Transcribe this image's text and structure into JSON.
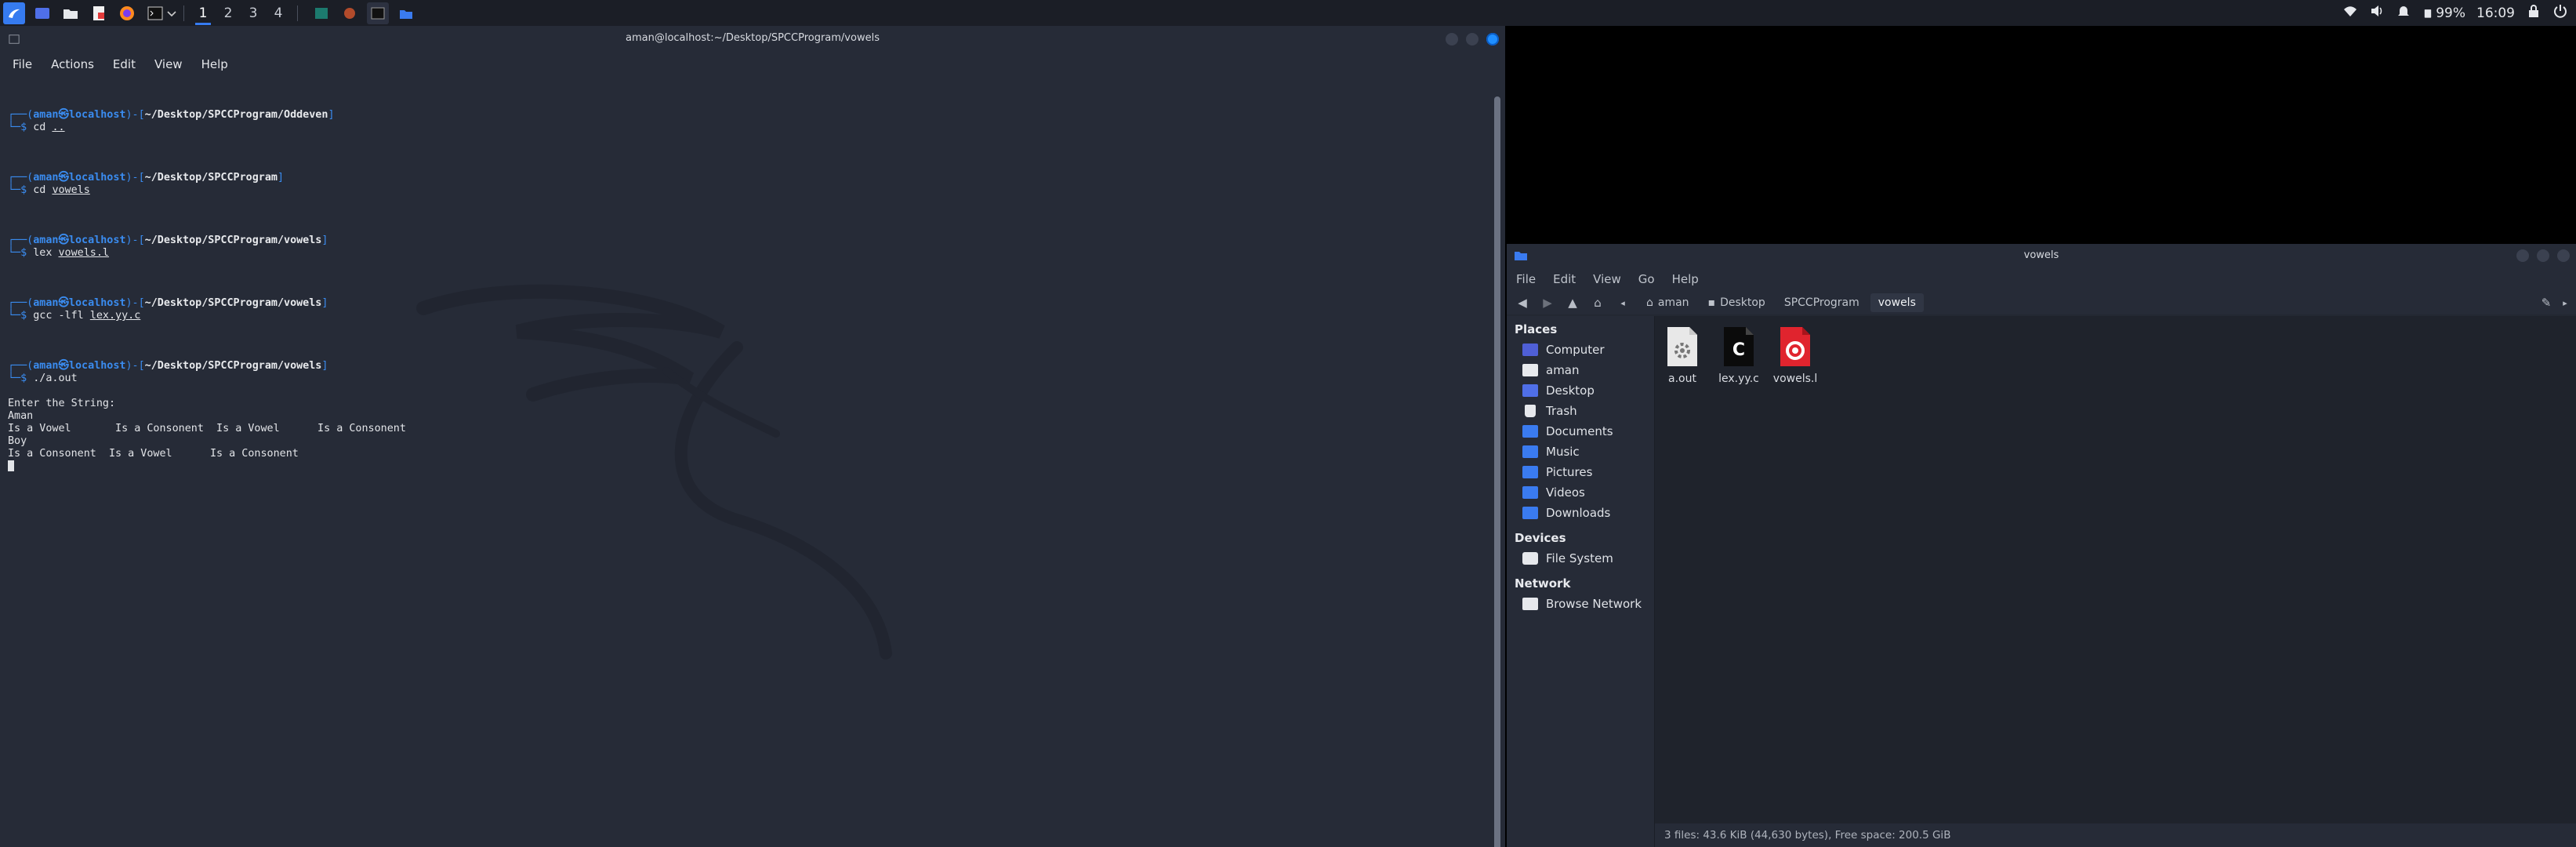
{
  "panel": {
    "workspaces": [
      "1",
      "2",
      "3",
      "4"
    ],
    "active_workspace": "1",
    "battery": "99%",
    "clock": "16:09"
  },
  "terminal": {
    "title": "aman@localhost:~/Desktop/SPCCProgram/vowels",
    "menu": [
      "File",
      "Actions",
      "Edit",
      "View",
      "Help"
    ],
    "prompts": [
      {
        "user": "aman㉿localhost",
        "path": "~/Desktop/SPCCProgram/Oddeven",
        "cmd": "cd",
        "arg": ".."
      },
      {
        "user": "aman㉿localhost",
        "path": "~/Desktop/SPCCProgram",
        "cmd": "cd",
        "arg": "vowels"
      },
      {
        "user": "aman㉿localhost",
        "path": "~/Desktop/SPCCProgram/vowels",
        "cmd": "lex",
        "arg": "vowels.l"
      },
      {
        "user": "aman㉿localhost",
        "path": "~/Desktop/SPCCProgram/vowels",
        "cmd": "gcc -lfl",
        "arg": "lex.yy.c"
      },
      {
        "user": "aman㉿localhost",
        "path": "~/Desktop/SPCCProgram/vowels",
        "cmd": "./a.out",
        "arg": ""
      }
    ],
    "output": [
      "Enter the String:",
      "Aman",
      "Is a Vowel       Is a Consonent  Is a Vowel      Is a Consonent",
      "Boy",
      "Is a Consonent  Is a Vowel      Is a Consonent"
    ]
  },
  "filemanager": {
    "title": "vowels",
    "menu": [
      "File",
      "Edit",
      "View",
      "Go",
      "Help"
    ],
    "breadcrumbs": [
      "aman",
      "Desktop",
      "SPCCProgram",
      "vowels"
    ],
    "places_heading": "Places",
    "places": [
      {
        "label": "Computer",
        "icon": "computer-icon"
      },
      {
        "label": "aman",
        "icon": "home-folder-icon"
      },
      {
        "label": "Desktop",
        "icon": "desktop-icon"
      },
      {
        "label": "Trash",
        "icon": "trash-icon"
      },
      {
        "label": "Documents",
        "icon": "documents-folder-icon"
      },
      {
        "label": "Music",
        "icon": "music-folder-icon"
      },
      {
        "label": "Pictures",
        "icon": "pictures-folder-icon"
      },
      {
        "label": "Videos",
        "icon": "videos-folder-icon"
      },
      {
        "label": "Downloads",
        "icon": "downloads-folder-icon"
      }
    ],
    "devices_heading": "Devices",
    "devices": [
      {
        "label": "File System",
        "icon": "drive-icon"
      }
    ],
    "network_heading": "Network",
    "network": [
      {
        "label": "Browse Network",
        "icon": "network-icon"
      }
    ],
    "files": [
      {
        "name": "a.out",
        "icon": "executable-file-icon"
      },
      {
        "name": "lex.yy.c",
        "icon": "c-source-file-icon"
      },
      {
        "name": "vowels.l",
        "icon": "lex-file-icon"
      }
    ],
    "status": "3 files: 43.6 KiB (44,630 bytes), Free space: 200.5 GiB"
  }
}
